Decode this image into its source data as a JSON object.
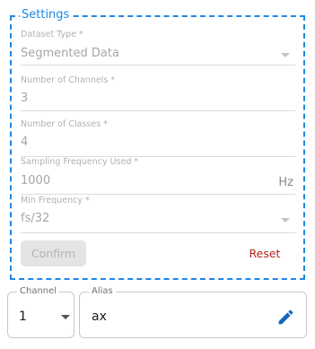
{
  "settings": {
    "title": "Settings",
    "dataset_type": {
      "label": "Dataset Type *",
      "value": "Segmented Data"
    },
    "num_channels": {
      "label": "Number of Channels *",
      "value": "3"
    },
    "num_classes": {
      "label": "Number of Classes *",
      "value": "4"
    },
    "sampling_frequency": {
      "label": "Sampling Frequency Used *",
      "value": "1000",
      "unit": "Hz"
    },
    "min_frequency": {
      "label": "Min Frequency *",
      "value": "fs/32"
    },
    "confirm_label": "Confirm",
    "reset_label": "Reset"
  },
  "channel": {
    "label": "Channel",
    "value": "1"
  },
  "alias": {
    "label": "Alias",
    "value": "ax"
  },
  "icons": {
    "select_caret": "chevron-down-icon",
    "edit": "pencil-edit-icon"
  },
  "colors": {
    "accent": "#1e88e5",
    "reset": "#b3261e",
    "edit_icon": "#1565c0"
  }
}
